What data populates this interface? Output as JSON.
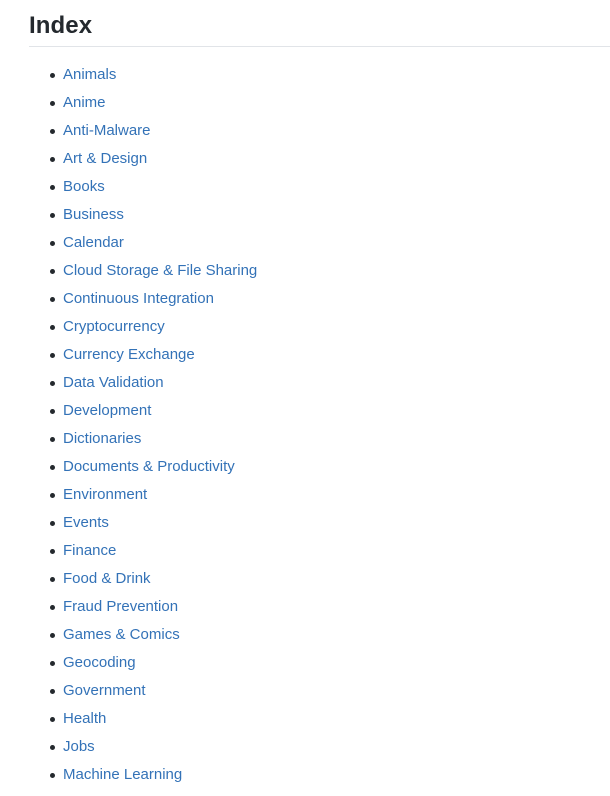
{
  "heading": {
    "title": "Index"
  },
  "colors": {
    "background": "#ffffff",
    "heading_text": "#24292e",
    "link": "#3372b7",
    "rule": "#e1e4e8",
    "bullet": "#24292e"
  },
  "index": {
    "items": [
      {
        "label": "Animals"
      },
      {
        "label": "Anime"
      },
      {
        "label": "Anti-Malware"
      },
      {
        "label": "Art & Design"
      },
      {
        "label": "Books"
      },
      {
        "label": "Business"
      },
      {
        "label": "Calendar"
      },
      {
        "label": "Cloud Storage & File Sharing"
      },
      {
        "label": "Continuous Integration"
      },
      {
        "label": "Cryptocurrency"
      },
      {
        "label": "Currency Exchange"
      },
      {
        "label": "Data Validation"
      },
      {
        "label": "Development"
      },
      {
        "label": "Dictionaries"
      },
      {
        "label": "Documents & Productivity"
      },
      {
        "label": "Environment"
      },
      {
        "label": "Events"
      },
      {
        "label": "Finance"
      },
      {
        "label": "Food & Drink"
      },
      {
        "label": "Fraud Prevention"
      },
      {
        "label": "Games & Comics"
      },
      {
        "label": "Geocoding"
      },
      {
        "label": "Government"
      },
      {
        "label": "Health"
      },
      {
        "label": "Jobs"
      },
      {
        "label": "Machine Learning"
      }
    ]
  }
}
